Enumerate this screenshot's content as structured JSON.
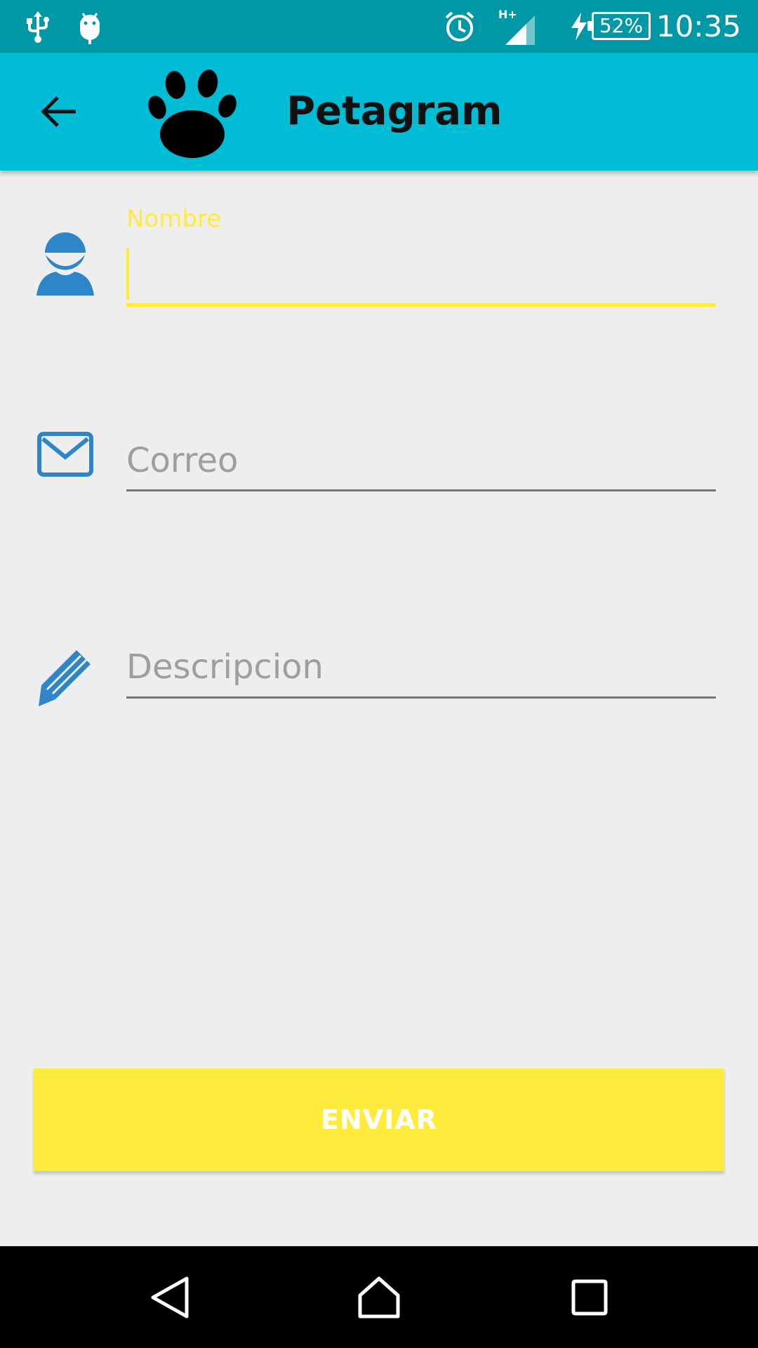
{
  "status_bar": {
    "time": "10:35",
    "battery": "52%",
    "network": "H+",
    "icons": [
      "usb-icon",
      "android-debug-icon",
      "alarm-icon",
      "signal-icon",
      "charging-icon",
      "battery-icon"
    ]
  },
  "app_bar": {
    "title": "Petagram",
    "back_icon": "arrow-back-icon",
    "logo_icon": "paw-icon",
    "color": "#00bcd4"
  },
  "form": {
    "nombre": {
      "label": "Nombre",
      "value": "",
      "icon": "person-icon",
      "active": true
    },
    "correo": {
      "placeholder": "Correo",
      "value": "",
      "icon": "mail-icon"
    },
    "descripcion": {
      "placeholder": "Descripcion",
      "value": "",
      "icon": "pencil-icon"
    },
    "accent_color": "#ffeb3b",
    "icon_color": "#2e86c8"
  },
  "submit": {
    "label": "ENVIAR",
    "color": "#ffeb3b"
  },
  "nav_bar": {
    "icons": [
      "nav-back-icon",
      "nav-home-icon",
      "nav-recents-icon"
    ]
  }
}
